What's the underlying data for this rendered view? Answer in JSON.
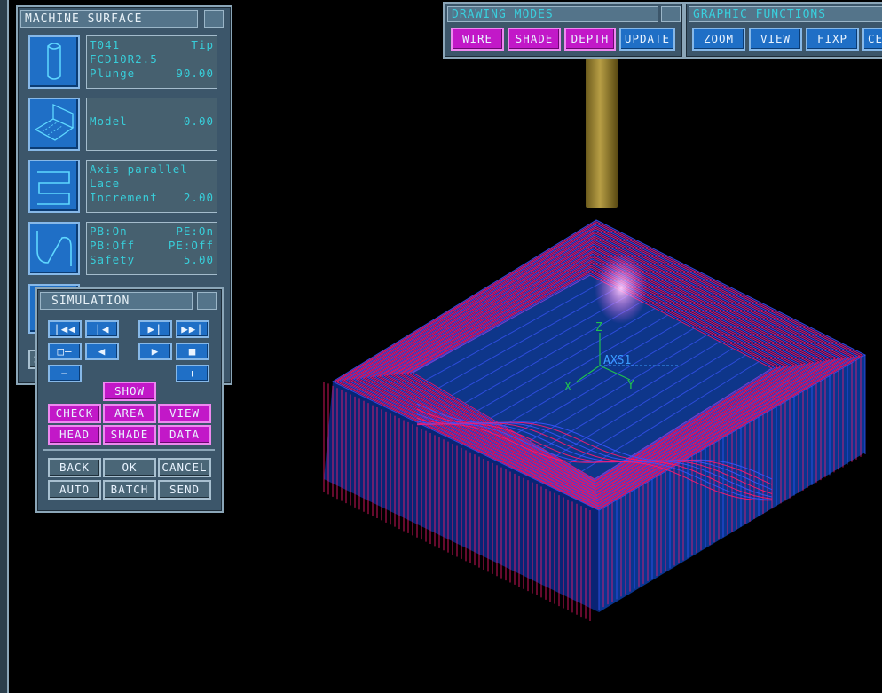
{
  "machine_surface": {
    "title": "MACHINE SURFACE",
    "tool": {
      "name": "T041",
      "tip": "Tip",
      "spec": "FCD10R2.5",
      "plunge_label": "Plunge",
      "plunge_value": "90.00"
    },
    "model": {
      "label": "Model",
      "value": "0.00"
    },
    "strategy": {
      "line1": "Axis parallel",
      "line2": "Lace",
      "increment_label": "Increment",
      "increment_value": "2.00"
    },
    "links": {
      "pb_on": "PB:On",
      "pe_on": "PE:On",
      "pb_off": "PB:Off",
      "pe_off": "PE:Off",
      "safety_label": "Safety",
      "safety_value": "5.00"
    },
    "partial_button": "S"
  },
  "simulation": {
    "title": "SIMULATION",
    "transport": {
      "first": "|◀◀",
      "prev": "|◀",
      "next": "▶|",
      "last": "▶▶|",
      "slider": "□—",
      "back": "◀",
      "play": "▶",
      "stop": "■",
      "minus": "−",
      "plus": "+"
    },
    "show": "SHOW",
    "options": [
      "CHECK",
      "AREA",
      "VIEW",
      "HEAD",
      "SHADE",
      "DATA"
    ],
    "bottom": [
      "BACK",
      "OK",
      "CANCEL",
      "AUTO",
      "BATCH",
      "SEND"
    ]
  },
  "drawing_modes": {
    "title": "DRAWING MODES",
    "buttons": [
      "WIRE",
      "SHADE",
      "DEPTH",
      "UPDATE"
    ]
  },
  "graphic_functions": {
    "title": "GRAPHIC FUNCTIONS",
    "buttons": [
      "ZOOM",
      "VIEW",
      "FIXP",
      "CE"
    ]
  },
  "viewport": {
    "axis_label": "AXS1",
    "x": "X",
    "y": "Y",
    "z": "Z"
  },
  "colors": {
    "toolpath": "#ff1a6e",
    "model": "#3a55ff",
    "accent": "#c218c8",
    "button": "#1f6fc6",
    "text": "#38cdd9"
  }
}
